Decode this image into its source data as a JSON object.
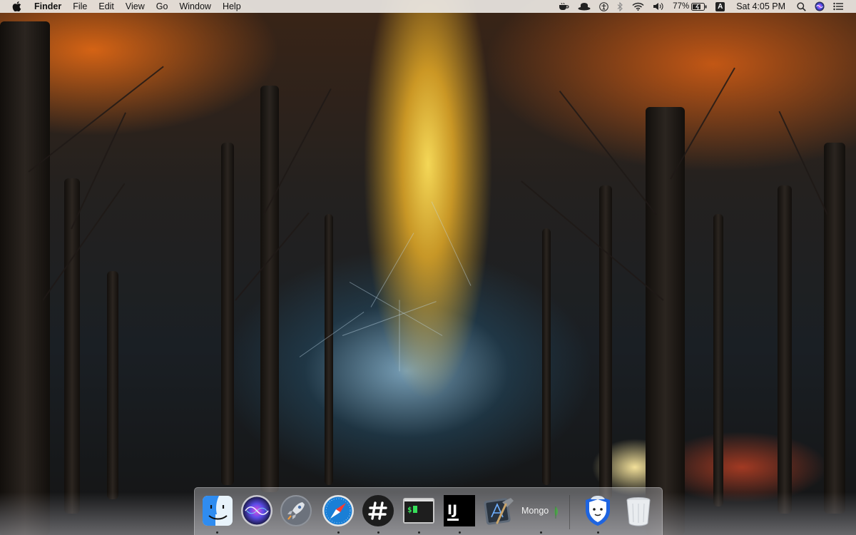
{
  "menubar": {
    "app_name": "Finder",
    "menus": [
      "File",
      "Edit",
      "View",
      "Go",
      "Window",
      "Help"
    ],
    "battery_percent": "77%",
    "input_source": "A",
    "clock": "Sat 4:05 PM",
    "status_icons": [
      "coffee-cup-icon",
      "hat-icon",
      "accessibility-icon",
      "bluetooth-icon",
      "wifi-icon",
      "volume-icon",
      "battery-icon",
      "input-source-icon",
      "spotlight-icon",
      "siri-icon",
      "notification-center-icon"
    ]
  },
  "desktop": {
    "wallpaper": "forest-path-sunset"
  },
  "dock": {
    "apps": [
      {
        "name": "finder",
        "running": true
      },
      {
        "name": "siri",
        "running": false
      },
      {
        "name": "launchpad",
        "running": false
      },
      {
        "name": "safari",
        "running": true
      },
      {
        "name": "slack",
        "running": true
      },
      {
        "name": "terminal",
        "running": true
      },
      {
        "name": "intellij",
        "running": true
      },
      {
        "name": "xcode",
        "running": false
      },
      {
        "name": "mongodb",
        "running": true
      }
    ],
    "mongodb_label": "Mongo",
    "other": [
      {
        "name": "betternet",
        "running": true
      },
      {
        "name": "trash",
        "running": false
      }
    ]
  },
  "colors": {
    "menubar_bg": "#ece8e4",
    "safari_blue": "#1a7fd6",
    "slack_bg": "#1d1d1d",
    "betternet_blue": "#1e64e0"
  }
}
